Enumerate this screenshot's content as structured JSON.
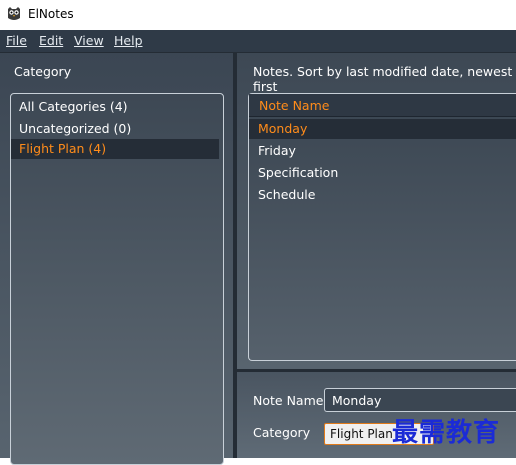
{
  "window": {
    "title": "ElNotes",
    "icon": "owl-icon"
  },
  "menu": {
    "items": [
      {
        "label": "File"
      },
      {
        "label": "Edit"
      },
      {
        "label": "View"
      },
      {
        "label": "Help"
      }
    ]
  },
  "category_panel": {
    "label": "Category",
    "items": [
      {
        "label": "All Categories (4)"
      },
      {
        "label": "Uncategorized (0)"
      },
      {
        "label": "Flight Plan (4)"
      }
    ],
    "selected": "Flight Plan (4)"
  },
  "notes_panel": {
    "label": "Notes. Sort by last modified date, newest first",
    "column_header": "Note Name",
    "items": [
      {
        "label": "Monday"
      },
      {
        "label": "Friday"
      },
      {
        "label": "Specification"
      },
      {
        "label": "Schedule"
      }
    ],
    "selected": "Monday"
  },
  "detail": {
    "note_name_label": "Note Name",
    "note_name_value": "Monday",
    "category_label": "Category",
    "category_value": "Flight Plan"
  },
  "watermark": "最需教育",
  "colors": {
    "accent": "#ff8c1a",
    "panel_dark": "#252d37",
    "panel": "#3d4854"
  }
}
